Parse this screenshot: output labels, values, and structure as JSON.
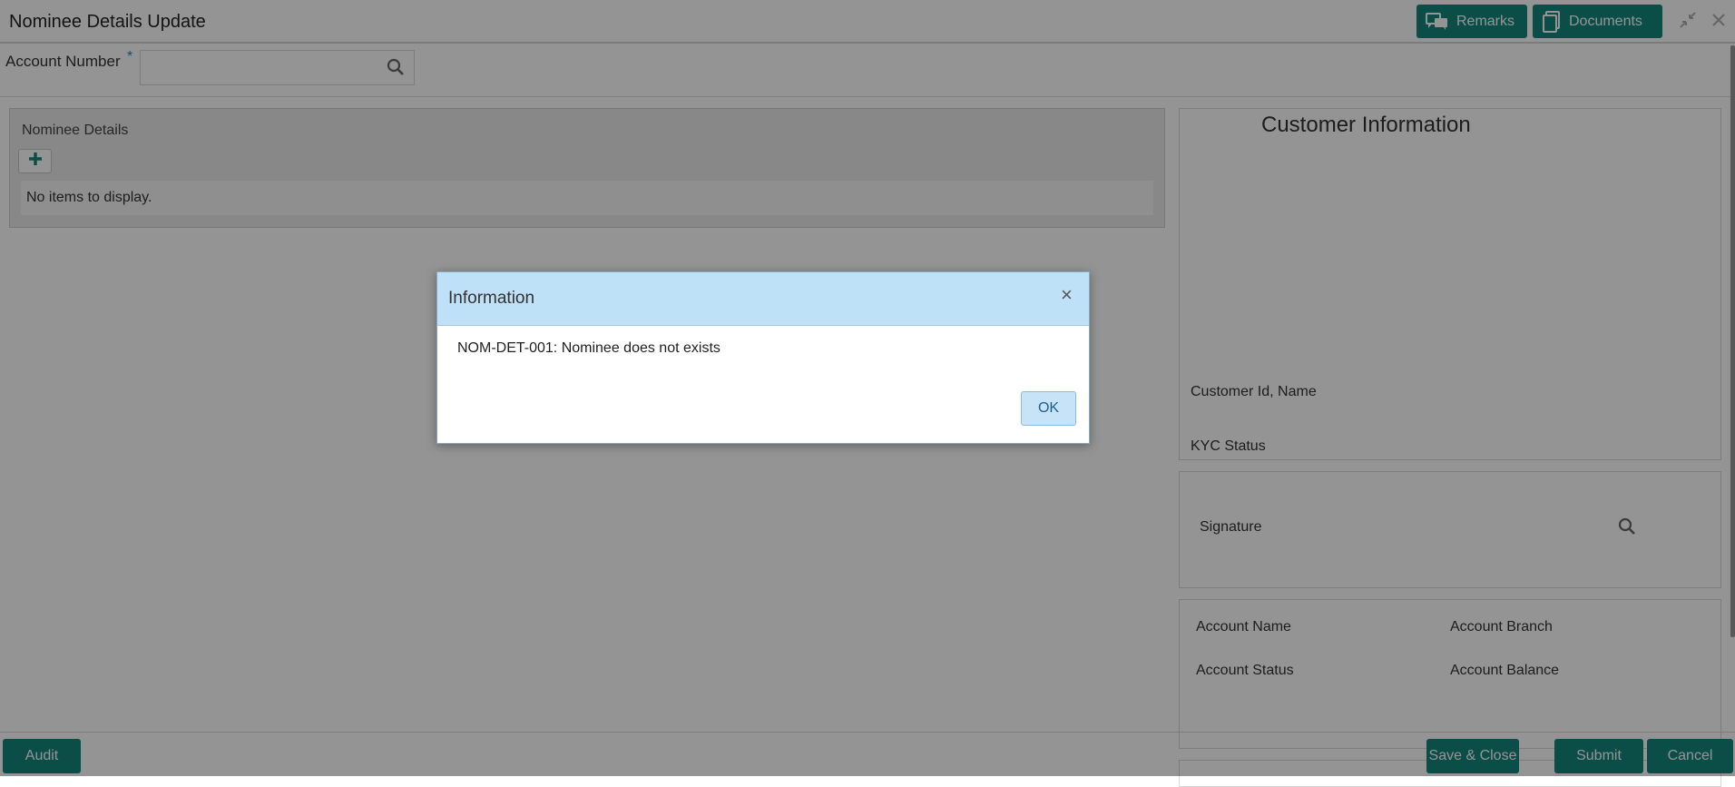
{
  "header": {
    "title": "Nominee Details Update",
    "remarks_label": "Remarks",
    "documents_label": "Documents"
  },
  "account": {
    "label": "Account Number",
    "required_mark": "*",
    "value": ""
  },
  "nominee": {
    "title": "Nominee Details",
    "empty_text": "No items to display."
  },
  "customer": {
    "title": "Customer Information",
    "id_name_label": "Customer Id, Name",
    "kyc_label": "KYC Status",
    "signature_label": "Signature",
    "account_name_label": "Account Name",
    "account_branch_label": "Account Branch",
    "account_status_label": "Account Status",
    "account_balance_label": "Account Balance"
  },
  "footer": {
    "audit_label": "Audit",
    "save_close_label": "Save & Close",
    "submit_label": "Submit",
    "cancel_label": "Cancel"
  },
  "dialog": {
    "title": "Information",
    "close_glyph": "×",
    "message": "NOM-DET-001: Nominee does not exists",
    "ok_label": "OK"
  },
  "colors": {
    "primary": "#13877c",
    "dialog_header": "#bfe1f8",
    "ok_button": "#c6e3f7"
  }
}
